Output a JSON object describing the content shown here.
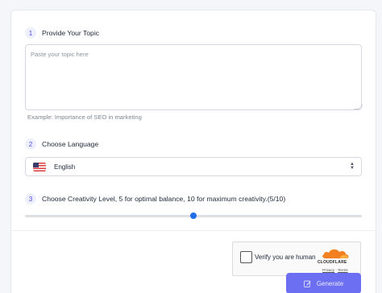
{
  "sections": {
    "topic": {
      "step": "1",
      "title": "Provide Your Topic",
      "placeholder": "Paste your topic here",
      "example": "Example:  Importance of SEO in marketing"
    },
    "language": {
      "step": "2",
      "title": "Choose Language",
      "selected": "English",
      "flag_icon": "us-flag-icon"
    },
    "creativity": {
      "step": "3",
      "title": "Choose Creativity Level, 5 for optimal balance, 10 for maximum creativity.(5/10)",
      "value": 5,
      "min": 0,
      "max": 10
    }
  },
  "captcha": {
    "label": "Verify you are human",
    "brand": "CLOUDFLARE",
    "privacy": "Privacy",
    "separator": " · ",
    "terms": "Terms"
  },
  "actions": {
    "generate_label": "Generate",
    "generate_icon": "edit-icon"
  },
  "colors": {
    "accent": "#6d6ff2",
    "slider_thumb": "#1f6feb",
    "step_badge_bg": "#eef0fc",
    "cloudflare_orange": "#f38020"
  }
}
